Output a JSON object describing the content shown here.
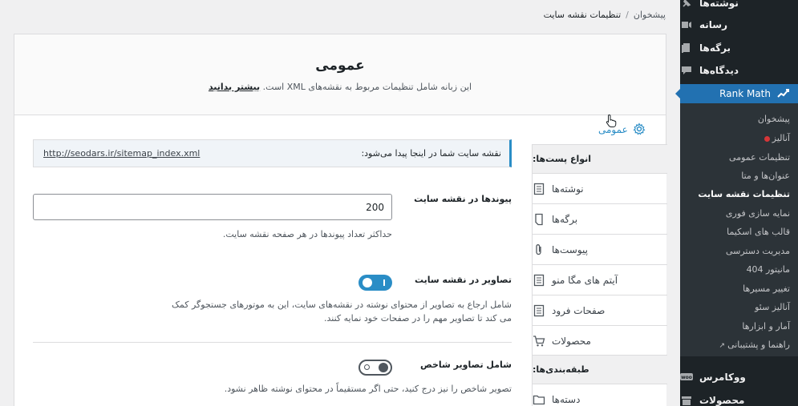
{
  "admin_menu": {
    "posts": "نوشته‌ها",
    "media": "رسانه",
    "pages": "برگه‌ها",
    "comments": "دیدگاه‌ها",
    "rank_math": "Rank Math",
    "woocommerce": "ووکامرس",
    "products": "محصولات"
  },
  "rank_math_submenu": [
    "پیشخوان",
    "آنالیز",
    "تنظیمات عمومی",
    "عنوان‌ها و متا",
    "تنظیمات نقشه سایت",
    "نمایه سازی فوری",
    "قالب های اسکیما",
    "مدیریت دسترسی",
    "مانیتور 404",
    "تغییر مسیرها",
    "آنالیز سئو",
    "آمار و ابزارها",
    "راهنما و پشتیبانی"
  ],
  "breadcrumb": {
    "home": "پیشخوان",
    "separator": "/",
    "current": "تنظیمات نقشه سایت"
  },
  "header": {
    "title": "عمومی",
    "description": "این زبانه شامل تنظیمات مربوط به نقشه‌های XML است.",
    "learn_more": "بیشتر بدانید"
  },
  "tabs": {
    "general": "عمومی",
    "post_types_heading": "انواع پست‌ها:",
    "post_types": [
      "نوشته‌ها",
      "برگه‌ها",
      "پیوست‌ها",
      "آیتم های مگا منو",
      "صفحات فرود",
      "محصولات"
    ],
    "taxonomies_heading": "طبقه‌بندی‌ها:",
    "taxonomies": [
      "دسته‌ها"
    ]
  },
  "settings": {
    "sitemap_notice_label": "نقشه سایت شما در اینجا پیدا می‌شود:",
    "sitemap_url": "http://seodars.ir/sitemap_index.xml",
    "links_per_sitemap_label": "پیوندها در نقشه سایت",
    "links_per_sitemap_value": "200",
    "links_per_sitemap_desc": "حداکثر تعداد پیوندها در هر صفحه نقشه سایت.",
    "images_label": "تصاویر در نقشه سایت",
    "images_enabled": true,
    "images_desc": "شامل ارجاع به تصاویر از محتوای نوشته در نقشه‌های سایت، این به موتورهای جستجوگر کمک می کند تا تصاویر مهم را در صفحات خود نمایه کنند.",
    "featured_label": "شامل تصاویر شاخص",
    "featured_enabled": false,
    "featured_desc": "تصویر شاخص را نیز درج کنید، حتی اگر مستقیماً در محتوای نوشته ظاهر نشود."
  },
  "colors": {
    "accent": "#2a8dc6",
    "admin_bar": "#1d2327",
    "menu_active": "#2271b1"
  }
}
